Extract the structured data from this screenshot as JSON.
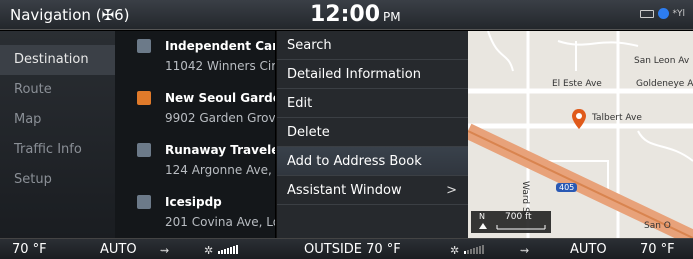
{
  "topbar": {
    "title": "Navigation",
    "count": "(✠6)",
    "clock": "12:00",
    "ampm": "PM"
  },
  "left_menu": {
    "items": [
      {
        "label": "Destination",
        "active": true
      },
      {
        "label": "Route",
        "active": false
      },
      {
        "label": "Map",
        "active": false
      },
      {
        "label": "Traffic Info",
        "active": false
      },
      {
        "label": "Setup",
        "active": false
      }
    ]
  },
  "destinations": [
    {
      "name": "Independent Car S",
      "address": "11042 Winners Cir",
      "icon": "car-icon"
    },
    {
      "name": "New Seoul Garden",
      "address": "9902 Garden Grov",
      "icon": "restaurant-icon"
    },
    {
      "name": "Runaway Traveler",
      "address": "124 Argonne Ave,",
      "icon": "building-icon"
    },
    {
      "name": "Icesipdp",
      "address": "201 Covina Ave, Lo",
      "icon": "building-icon"
    }
  ],
  "context_menu": {
    "items": [
      {
        "label": "Search"
      },
      {
        "label": "Detailed Information"
      },
      {
        "label": "Edit"
      },
      {
        "label": "Delete"
      },
      {
        "label": "Add to Address Book",
        "selected": true
      },
      {
        "label": "Assistant Window",
        "chevron": ">"
      }
    ]
  },
  "map": {
    "labels": {
      "san_leon": "San Leon Av",
      "el_este": "El Este Ave",
      "goldeneye": "Goldeneye A",
      "talbert": "Talbert Ave",
      "ward": "Ward St",
      "san": "San O",
      "highway": "405"
    },
    "scale": {
      "north": "N",
      "distance": "700 ft"
    },
    "pin_color": "#e05a1a"
  },
  "climate": {
    "left_temp": "70 °F",
    "left_mode": "AUTO",
    "outside": "OUTSIDE 70 °F",
    "right_mode": "AUTO",
    "right_temp": "70 °F",
    "fan_level_left": 1.0,
    "fan_level_right": 0.2
  }
}
